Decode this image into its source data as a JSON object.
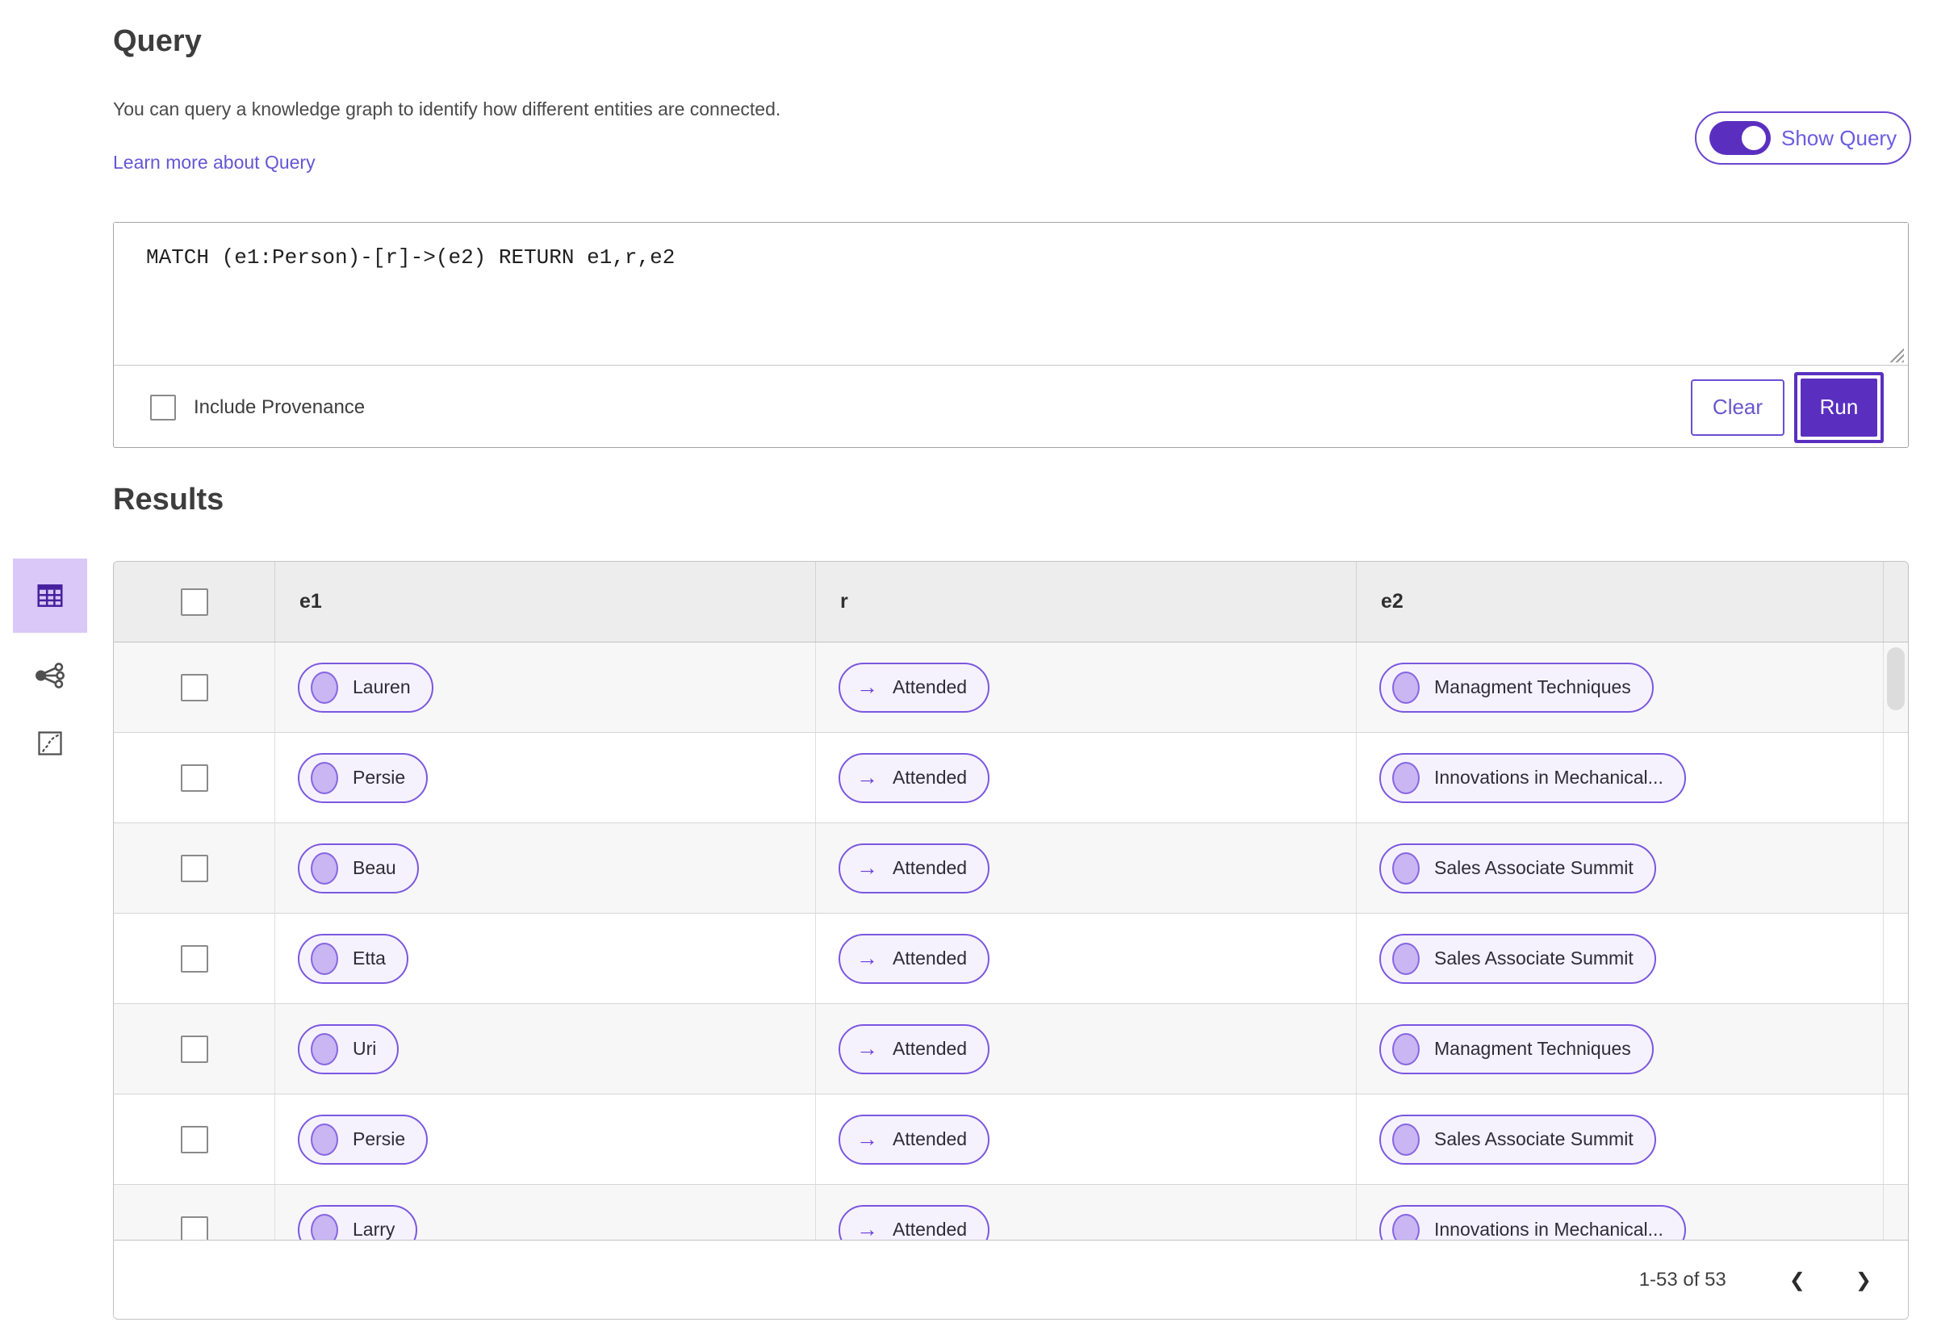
{
  "query": {
    "title": "Query",
    "description": "You can query a knowledge graph to identify how different entities are connected.",
    "learn_more_link": "Learn more about Query",
    "show_query_toggle": {
      "label": "Show Query",
      "state": "on"
    },
    "editor_text": "MATCH (e1:Person)-[r]->(e2) RETURN e1,r,e2",
    "include_provenance": {
      "label": "Include Provenance",
      "checked": false
    },
    "clear_button": "Clear",
    "run_button": "Run"
  },
  "results": {
    "title": "Results",
    "table": {
      "columns": [
        "e1",
        "r",
        "e2"
      ],
      "rows": [
        {
          "e1": "Lauren",
          "r": "Attended",
          "e2": "Managment Techniques"
        },
        {
          "e1": "Persie",
          "r": "Attended",
          "e2": "Innovations in Mechanical..."
        },
        {
          "e1": "Beau",
          "r": "Attended",
          "e2": "Sales Associate Summit"
        },
        {
          "e1": "Etta",
          "r": "Attended",
          "e2": "Sales Associate Summit"
        },
        {
          "e1": "Uri",
          "r": "Attended",
          "e2": "Managment Techniques"
        },
        {
          "e1": "Persie",
          "r": "Attended",
          "e2": "Sales Associate Summit"
        },
        {
          "e1": "Larry",
          "r": "Attended",
          "e2": "Innovations in Mechanical..."
        }
      ]
    },
    "pagination": {
      "range_label": "1-53 of 53"
    }
  },
  "icons": {
    "arrow_right": "→",
    "chevron_left": "❮",
    "chevron_right": "❯"
  },
  "colors": {
    "accent_purple": "#5a2fc0",
    "pill_border": "#7b57e0",
    "pill_background": "#f5f2fd",
    "link_purple": "#6456d4",
    "selected_view_background": "#d9c8f8",
    "header_background": "#ededed",
    "row_shade": "#f7f7f7"
  }
}
